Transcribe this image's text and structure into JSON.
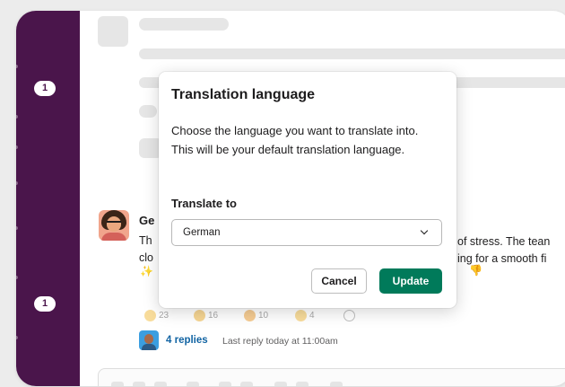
{
  "sidebar": {
    "badges": [
      "1",
      "1"
    ],
    "color": "#4a154b"
  },
  "message": {
    "author": "Ge",
    "lines": [
      "Th",
      "clo"
    ],
    "line_tails": [
      "of stress. The tean",
      "ing for a smooth fi"
    ]
  },
  "thread": {
    "replies_label": "4 replies",
    "last_reply": "Last reply today at 11:00am",
    "link_color": "#1264a3"
  },
  "reactions": [
    {
      "icon": "thumbs-up-icon",
      "count": "23"
    },
    {
      "icon": "smiley-icon",
      "count": "16"
    },
    {
      "icon": "grin-icon",
      "count": "10"
    },
    {
      "icon": "clap-icon",
      "count": "4"
    },
    {
      "icon": "add-reaction-icon",
      "count": ""
    }
  ],
  "modal": {
    "title": "Translation language",
    "description": "Choose the language you want to translate into. This will be your default translation language.",
    "field_label": "Translate to",
    "select_value": "German",
    "cancel_label": "Cancel",
    "update_label": "Update",
    "primary_color": "#007a5a"
  }
}
